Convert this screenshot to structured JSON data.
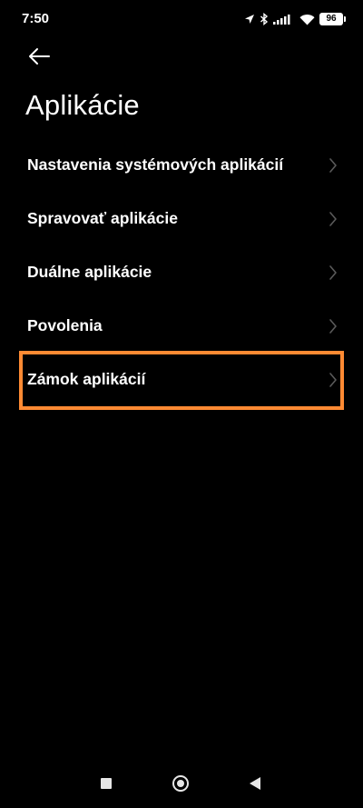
{
  "status_bar": {
    "time": "7:50",
    "battery": "96",
    "icons": [
      "location-icon",
      "bluetooth-icon",
      "signal-icon",
      "wifi-icon",
      "battery-icon"
    ]
  },
  "header": {
    "back_icon": "arrow-left-icon",
    "title": "Aplikácie"
  },
  "settings": {
    "items": [
      {
        "label": "Nastavenia systémových aplikácií",
        "icon": "chevron-right-icon"
      },
      {
        "label": "Spravovať aplikácie",
        "icon": "chevron-right-icon"
      },
      {
        "label": "Duálne aplikácie",
        "icon": "chevron-right-icon"
      },
      {
        "label": "Povolenia",
        "icon": "chevron-right-icon"
      },
      {
        "label": "Zámok aplikácií",
        "icon": "chevron-right-icon",
        "highlighted": true
      }
    ]
  },
  "highlight_color": "#ff8a33",
  "nav_bar": {
    "icons": [
      "recents-icon",
      "home-icon",
      "back-triangle-icon"
    ]
  }
}
